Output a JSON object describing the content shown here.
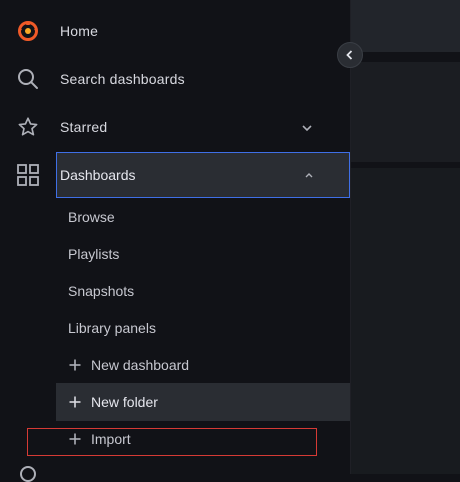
{
  "nav": {
    "home": "Home",
    "search": "Search dashboards",
    "starred": "Starred",
    "dashboards": "Dashboards"
  },
  "dashboards_menu": {
    "browse": "Browse",
    "playlists": "Playlists",
    "snapshots": "Snapshots",
    "library_panels": "Library panels",
    "new_dashboard": "New dashboard",
    "new_folder": "New folder",
    "import": "Import"
  },
  "colors": {
    "accent_blue": "#3f6fe6",
    "highlight_red": "#d63a35",
    "logo_orange": "#f05a28"
  },
  "icons": {
    "home": "grafana-logo-icon",
    "search": "search-icon",
    "starred": "star-icon",
    "dashboards": "apps-grid-icon",
    "collapse": "chevron-left-icon"
  }
}
